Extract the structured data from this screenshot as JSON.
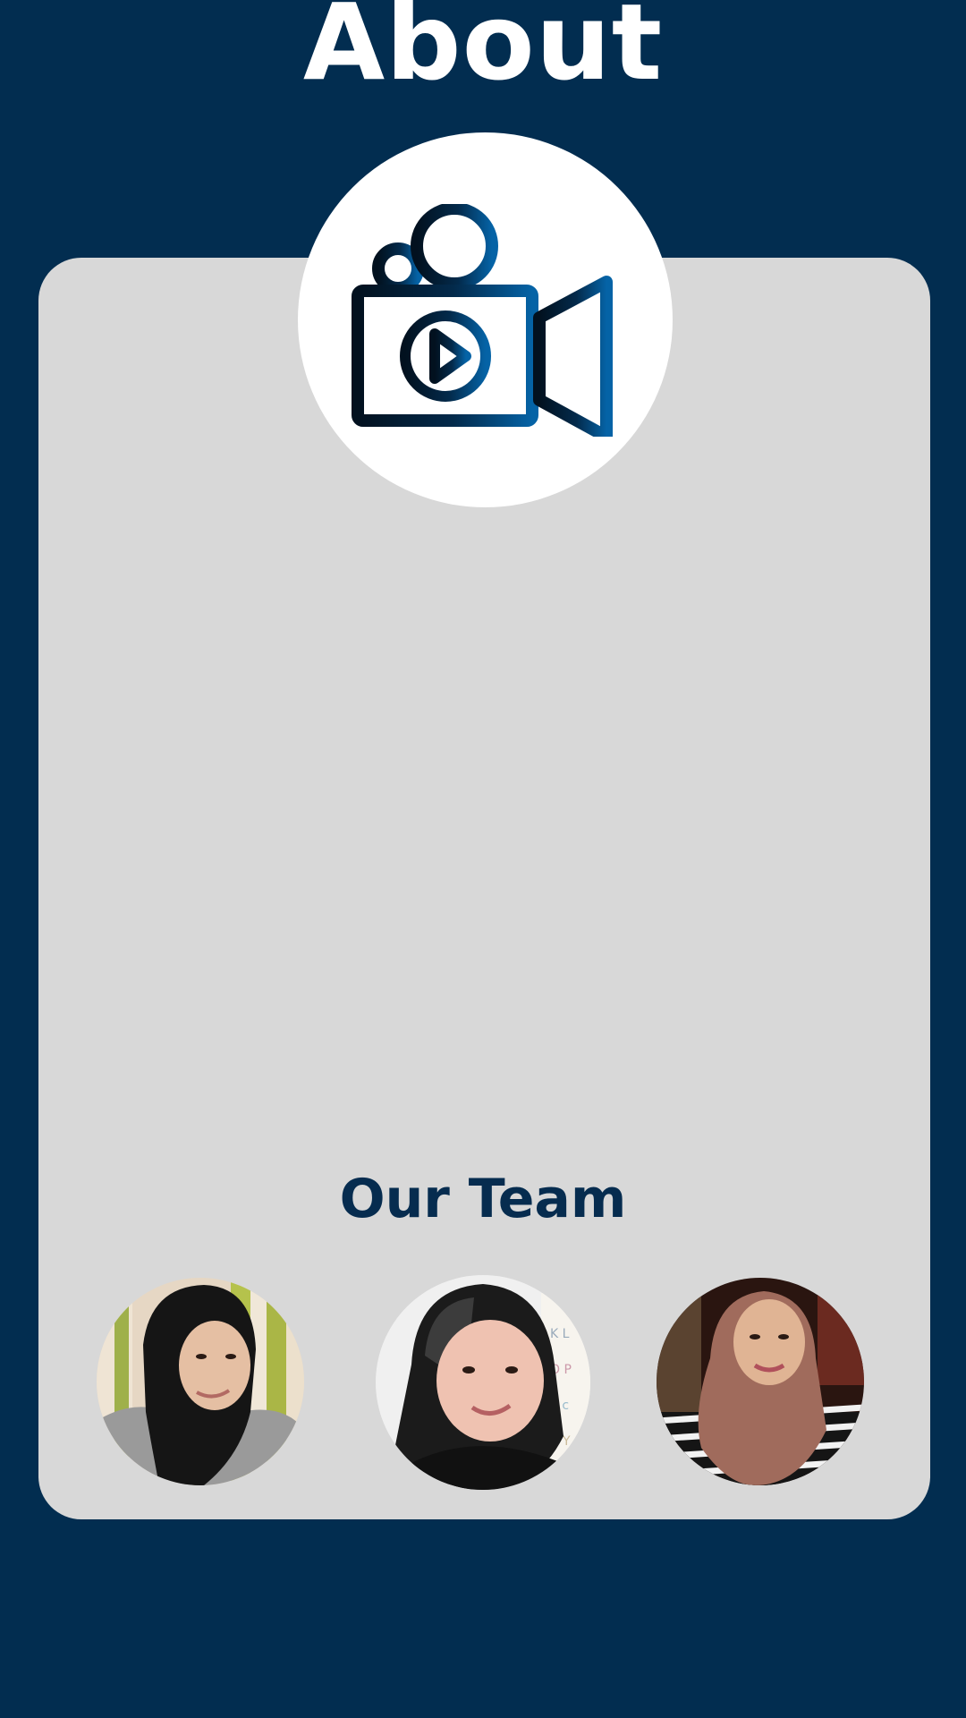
{
  "page": {
    "title": "About"
  },
  "logo": {
    "icon": "video-camera-play-icon"
  },
  "team": {
    "heading": "Our Team",
    "members": [
      {
        "avatar": "team-member-photo-1"
      },
      {
        "avatar": "team-member-photo-2"
      },
      {
        "avatar": "team-member-photo-3"
      }
    ]
  },
  "colors": {
    "background": "#022d50",
    "card": "#d8d8d8",
    "heading_dark": "#062c4f",
    "white": "#ffffff",
    "icon_gradient_start": "#02111f",
    "icon_gradient_end": "#0563a6"
  }
}
